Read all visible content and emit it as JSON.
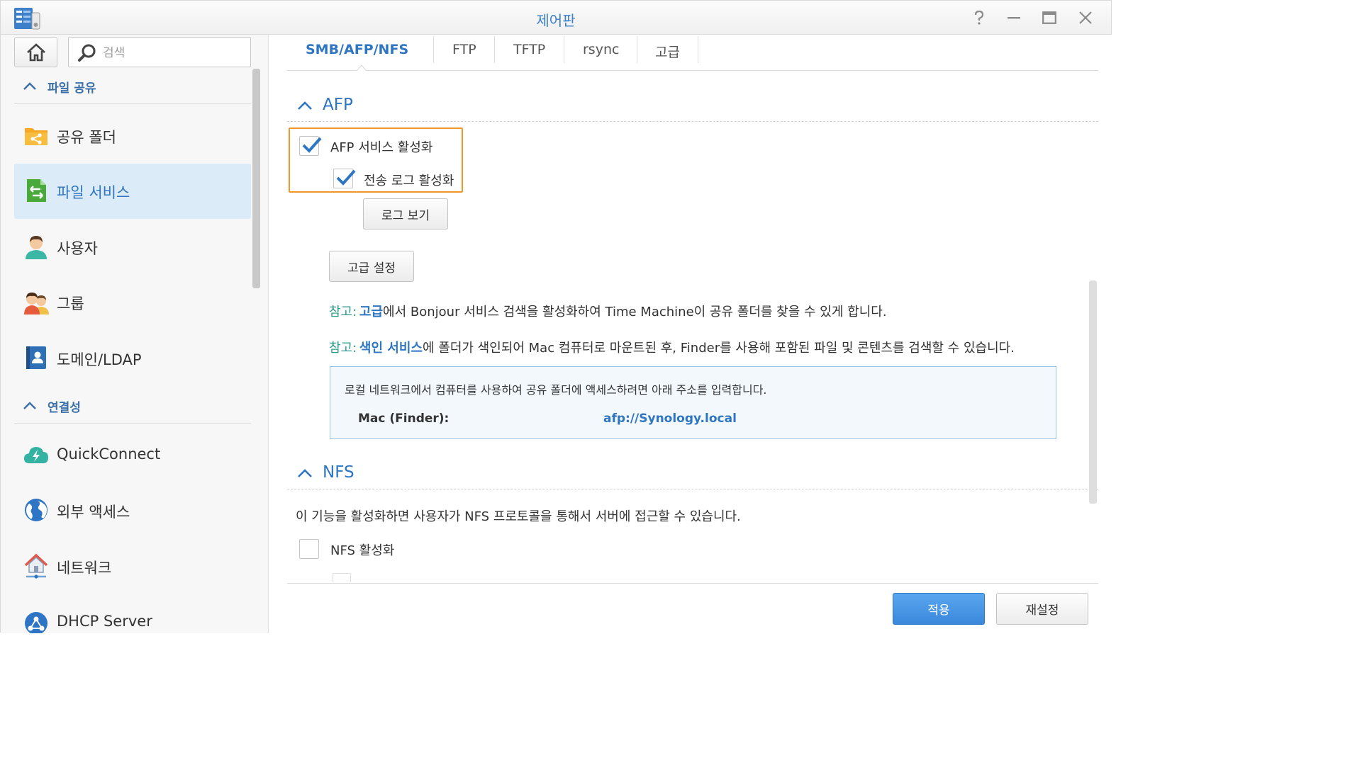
{
  "window": {
    "title": "제어판"
  },
  "sidebar": {
    "search_placeholder": "검색",
    "sections": [
      {
        "label": "파일 공유"
      },
      {
        "label": "연결성"
      }
    ],
    "items": [
      {
        "label": "공유 폴더",
        "icon": "shared-folder-icon"
      },
      {
        "label": "파일 서비스",
        "icon": "file-services-icon",
        "active": true
      },
      {
        "label": "사용자",
        "icon": "user-icon"
      },
      {
        "label": "그룹",
        "icon": "group-icon"
      },
      {
        "label": "도메인/LDAP",
        "icon": "domain-ldap-icon"
      },
      {
        "label": "QuickConnect",
        "icon": "quickconnect-icon"
      },
      {
        "label": "외부 액세스",
        "icon": "external-access-icon"
      },
      {
        "label": "네트워크",
        "icon": "network-icon"
      },
      {
        "label": "DHCP Server",
        "icon": "dhcp-server-icon"
      }
    ]
  },
  "tabs": [
    {
      "label": "SMB/AFP/NFS",
      "active": true
    },
    {
      "label": "FTP"
    },
    {
      "label": "TFTP"
    },
    {
      "label": "rsync"
    },
    {
      "label": "고급"
    }
  ],
  "afp": {
    "title": "AFP",
    "enable_label": "AFP 서비스 활성화",
    "enable_checked": true,
    "log_label": "전송 로그 활성화",
    "log_checked": true,
    "view_log_button": "로그 보기",
    "advanced_button": "고급 설정",
    "note1": {
      "prefix": "참고:",
      "link": "고급",
      "text": "에서 Bonjour 서비스 검색을 활성화하여 Time Machine이 공유 폴더를 찾을 수 있게 합니다."
    },
    "note2": {
      "prefix": "참고:",
      "link": "색인 서비스",
      "text": "에 폴더가 색인되어 Mac 컴퓨터로 마운트된 후, Finder를 사용해 포함된 파일 및 콘텐츠를 검색할 수 있습니다."
    },
    "info": {
      "description": "로컬 네트워크에서 컴퓨터를 사용하여 공유 폴더에 액세스하려면 아래 주소를 입력합니다.",
      "key": "Mac (Finder):",
      "value": "afp://Synology.local"
    }
  },
  "nfs": {
    "title": "NFS",
    "description": "이 기능을 활성화하면 사용자가 NFS 프로토콜을 통해서 서버에 접근할 수 있습니다.",
    "enable_label": "NFS 활성화",
    "enable_checked": false
  },
  "footer": {
    "apply": "적용",
    "reset": "재설정"
  },
  "colors": {
    "accent": "#2f76c2",
    "highlight": "#f0962a",
    "note_key": "#2e9b8e",
    "active_bg": "#dcebf8"
  }
}
